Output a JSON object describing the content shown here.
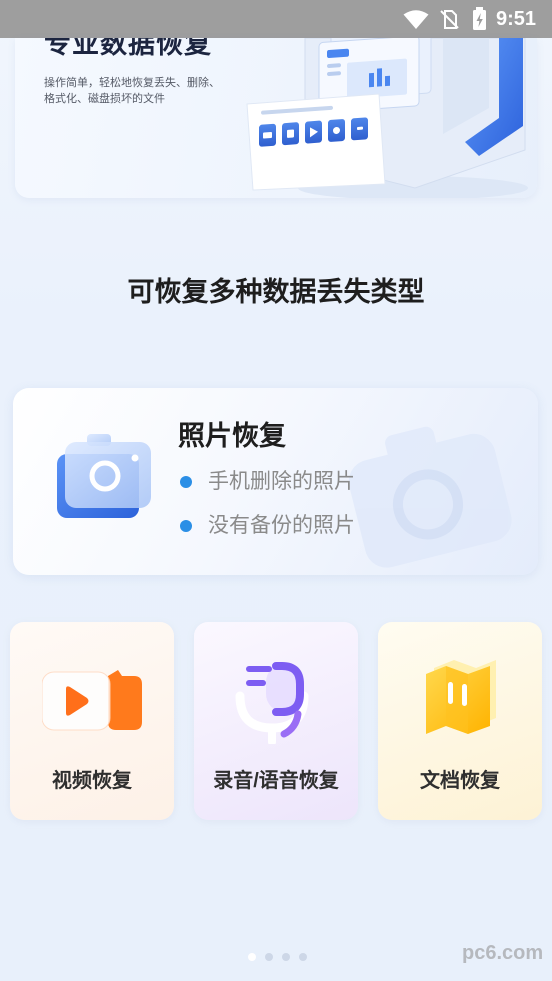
{
  "status_bar": {
    "time": "9:51",
    "icons": [
      "wifi-icon",
      "no-sim-icon",
      "battery-charging-icon"
    ],
    "background": "#9e9e9e"
  },
  "banner": {
    "title": "专业数据恢复",
    "description": [
      "操作简单，轻松地恢复丢失、删除、",
      "格式化、磁盘损坏的文件"
    ],
    "illustration": "data-recovery-illustration"
  },
  "section_heading": "可恢复多种数据丢失类型",
  "photo_card": {
    "title": "照片恢复",
    "icon": "camera-icon",
    "bullets": [
      "手机删除的照片",
      "没有备份的照片"
    ],
    "bullet_color": "#2b8fe6"
  },
  "feature_cards": [
    {
      "label": "视频恢复",
      "icon": "video-icon",
      "accent": "#ff7a1c"
    },
    {
      "label": "录音/语音恢复",
      "icon": "microphone-icon",
      "accent": "#7d5df2"
    },
    {
      "label": "文档恢复",
      "icon": "document-icon",
      "accent": "#ffc21f"
    }
  ],
  "pager": {
    "page_count": 4,
    "current_page": 1
  },
  "watermark": "pc6.com",
  "colors": {
    "page_background": "#e9f1fc",
    "heading_text": "#1e1e1e",
    "bullet_text": "#8a8a8a"
  }
}
